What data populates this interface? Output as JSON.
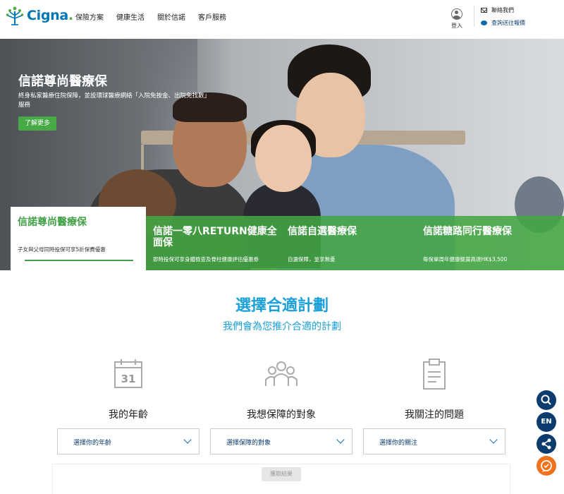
{
  "header": {
    "logo_text": "Cigna",
    "logo_dot": ".",
    "nav": [
      "保險方案",
      "健康生活",
      "關於信諾",
      "客戶服務"
    ],
    "login_label": "登入",
    "contact_label": "聯絡我們",
    "track_label": "查詢送往報價"
  },
  "hero": {
    "title": "信諾尊尚醫療保",
    "description": "終身私家醫療住院保障，並設環球醫療網絡「入院免按金、出院免找數」服務",
    "cta": "了解更多"
  },
  "product_tabs": [
    {
      "title": "信諾尊尚醫療保",
      "subtitle": "子女與父母同時投保可享5折保費優惠",
      "active": true
    },
    {
      "title": "信諾一零八RETURN健康全面保",
      "subtitle": "即時投保可享身體檢查及脊柱健康評估優惠券",
      "active": false
    },
    {
      "title": "信諾自選醫療保",
      "subtitle": "自選保障，並享無憂",
      "active": false
    },
    {
      "title": "信諾糖路同行醫療保",
      "subtitle": "每保單周年健康獎賞高達HK$3,500",
      "active": false
    }
  ],
  "selector": {
    "title": "選擇合適計劃",
    "subtitle": "我們會為您推介合適的計劃",
    "columns": [
      {
        "icon": "calendar-icon",
        "calendar_number": "31",
        "label": "我的年齡",
        "placeholder": "選擇你的年齡"
      },
      {
        "icon": "people-icon",
        "label": "我想保障的對象",
        "placeholder": "選擇保障的對象"
      },
      {
        "icon": "clipboard-icon",
        "label": "我關注的問題",
        "placeholder": "選擇你的關注"
      }
    ],
    "result_button": "獲取結果"
  },
  "floating": {
    "lang": "EN",
    "icons": [
      "search-icon",
      "share-icon",
      "chat-icon"
    ]
  },
  "colors": {
    "brand_blue": "#0077b3",
    "green": "#43a047",
    "heading_blue": "#1aa0d8",
    "navy": "#0b3c6d",
    "orange": "#f2711c"
  }
}
